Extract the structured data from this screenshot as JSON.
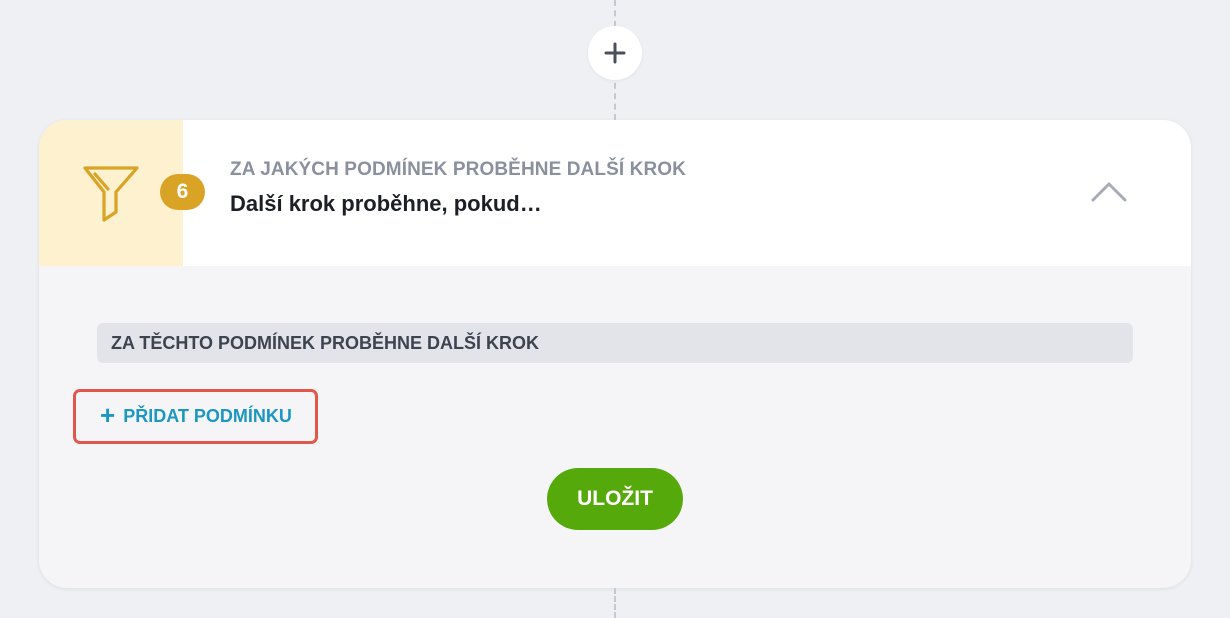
{
  "add_step": {
    "icon": "plus-icon"
  },
  "step": {
    "number": "6",
    "icon": "filter-icon",
    "subtitle": "ZA JAKÝCH PODMÍNEK PROBĚHNE DALŠÍ KROK",
    "title": "Další krok proběhne, pokud…",
    "collapse_icon": "chevron-up-icon"
  },
  "conditions": {
    "section_label": "ZA TĚCHTO PODMÍNEK PROBĚHNE DALŠÍ KROK",
    "add_condition_label": "PŘIDAT PODMÍNKU",
    "add_condition_icon": "plus-icon"
  },
  "save_label": "ULOŽIT",
  "colors": {
    "accent": "#1b97c1",
    "save": "#56a90a",
    "badge": "#d9a326",
    "icon_bg": "#fdf1cf",
    "highlight": "#e2574c"
  }
}
